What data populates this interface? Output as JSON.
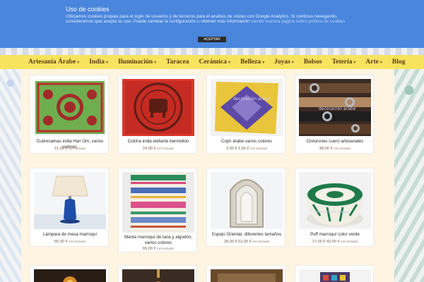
{
  "cookie": {
    "title": "Uso de cookies",
    "text": "Utilizamos cookies propias para el login de usuarios y de terceros para el analisis de visitas con Google Analytics. Si continua navegando, consideramos que acepta su uso. Puede cambiar la configuración u obtener más información",
    "link": "viendo nuestra página sobre política de cookies",
    "accept": "ACEPTAR"
  },
  "nav": {
    "items": [
      {
        "label": "Artesanía Árabe",
        "dropdown": true
      },
      {
        "label": "India",
        "dropdown": true
      },
      {
        "label": "Iluminación",
        "dropdown": true
      },
      {
        "label": "Taracea",
        "dropdown": false
      },
      {
        "label": "Cerámica",
        "dropdown": true
      },
      {
        "label": "Belleza",
        "dropdown": true
      },
      {
        "label": "Joyas",
        "dropdown": true
      },
      {
        "label": "Bolsos",
        "dropdown": false
      },
      {
        "label": "Tetería",
        "dropdown": true
      },
      {
        "label": "Arte",
        "dropdown": true
      },
      {
        "label": "Blog",
        "dropdown": false
      }
    ],
    "chevron": "▾"
  },
  "products": [
    {
      "name": "Cubrecamas india Hari Om, varios colores",
      "price": "21,00 €",
      "vat": "IVA Incluido"
    },
    {
      "name": "Colcha india elefante bermellón",
      "price": "24,00 €",
      "vat": "IVA Incluido"
    },
    {
      "name": "Cojín árabe varios colores",
      "price": "3,00 € 5,50 €",
      "vat": "IVA Incluido",
      "watermark": "decoración árabe"
    },
    {
      "name": "Cinturones cuero artesanales",
      "price": "48,00 €",
      "vat": "IVA Incluido",
      "watermark": "decoración árabe"
    },
    {
      "name": "Lámpara de mesa marroquí",
      "price": "65,00 €",
      "vat": "IVA Incluido"
    },
    {
      "name": "Manta marroquí de lana y algodón, varios colores",
      "price": "65,00 €",
      "vat": "IVA Incluido"
    },
    {
      "name": "Espejo Oriental, diferentes tamaños",
      "price": "28,00 € 52,00 €",
      "vat": "IVA Incluido"
    },
    {
      "name": "Puff marroquí color verde",
      "price": "17,00 € 42,00 €",
      "vat": "IVA Incluido",
      "watermark": "decoración árabe"
    }
  ],
  "colors": {
    "cookie_bg": "#4a86dc",
    "nav_bg": "#f7e35e",
    "content_bg": "#fdf4e2",
    "nav_text": "#5a3a17"
  }
}
